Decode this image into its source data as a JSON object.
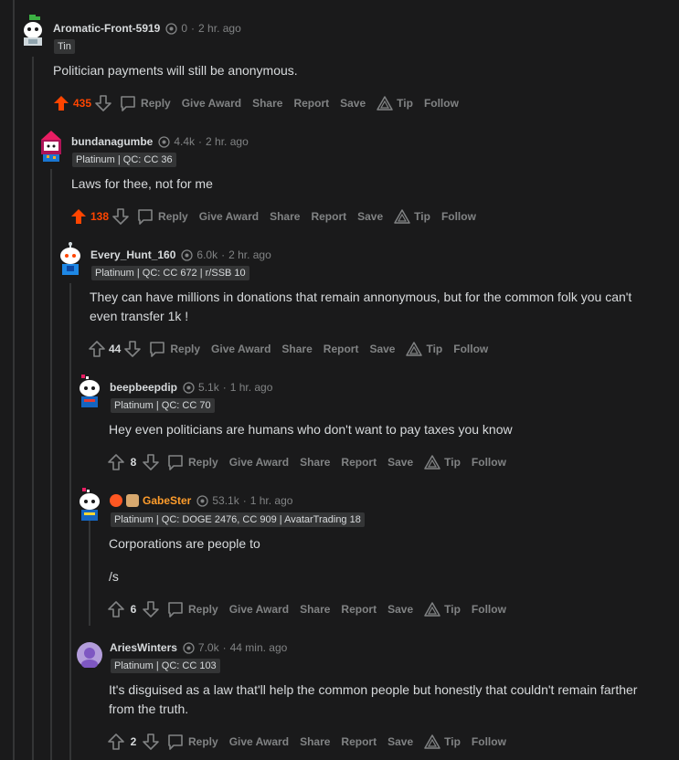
{
  "colors": {
    "upvoted": "#ff4500",
    "meta": "#818384",
    "text": "#d7dadc",
    "flair_bg": "#343536",
    "username_accent": "#ff9d2c"
  },
  "comments": [
    {
      "username": "Aromatic-Front-5919",
      "karma": "0",
      "time": "2 hr. ago",
      "flair": "Tin",
      "body": [
        "Politician payments will still be anonymous."
      ],
      "score": "435",
      "upvoted": true,
      "actions": {
        "reply": "Reply",
        "give_award": "Give Award",
        "share": "Share",
        "report": "Report",
        "save": "Save",
        "tip": "Tip",
        "follow": "Follow"
      }
    },
    {
      "username": "bundanagumbe",
      "karma": "4.4k",
      "time": "2 hr. ago",
      "flair": "Platinum | QC: CC 36",
      "body": [
        "Laws for thee, not for me"
      ],
      "score": "138",
      "upvoted": true,
      "actions": {
        "reply": "Reply",
        "give_award": "Give Award",
        "share": "Share",
        "report": "Report",
        "save": "Save",
        "tip": "Tip",
        "follow": "Follow"
      }
    },
    {
      "username": "Every_Hunt_160",
      "karma": "6.0k",
      "time": "2 hr. ago",
      "flair": "Platinum | QC: CC 672 | r/SSB 10",
      "body": [
        "They can have millions in donations that remain annonymous, but for the common folk you can't even transfer 1k !"
      ],
      "score": "44",
      "upvoted": false,
      "actions": {
        "reply": "Reply",
        "give_award": "Give Award",
        "share": "Share",
        "report": "Report",
        "save": "Save",
        "tip": "Tip",
        "follow": "Follow"
      }
    },
    {
      "username": "beepbeepdip",
      "karma": "5.1k",
      "time": "1 hr. ago",
      "flair": "Platinum | QC: CC 70",
      "body": [
        "Hey even politicians are humans who don't want to pay taxes you know"
      ],
      "score": "8",
      "upvoted": false,
      "actions": {
        "reply": "Reply",
        "give_award": "Give Award",
        "share": "Share",
        "report": "Report",
        "save": "Save",
        "tip": "Tip",
        "follow": "Follow"
      }
    },
    {
      "username": "GabeSter",
      "karma": "53.1k",
      "time": "1 hr. ago",
      "flair": "Platinum | QC: DOGE 2476, CC 909 | AvatarTrading 18",
      "body": [
        "Corporations are people to",
        "/s"
      ],
      "score": "6",
      "upvoted": false,
      "actions": {
        "reply": "Reply",
        "give_award": "Give Award",
        "share": "Share",
        "report": "Report",
        "save": "Save",
        "tip": "Tip",
        "follow": "Follow"
      }
    },
    {
      "username": "AriesWinters",
      "karma": "7.0k",
      "time": "44 min. ago",
      "flair": "Platinum | QC: CC 103",
      "body": [
        "It's disguised as a law that'll help the common people but honestly that couldn't remain farther from the truth."
      ],
      "score": "2",
      "upvoted": false,
      "actions": {
        "reply": "Reply",
        "give_award": "Give Award",
        "share": "Share",
        "report": "Report",
        "save": "Save",
        "tip": "Tip",
        "follow": "Follow"
      }
    }
  ]
}
